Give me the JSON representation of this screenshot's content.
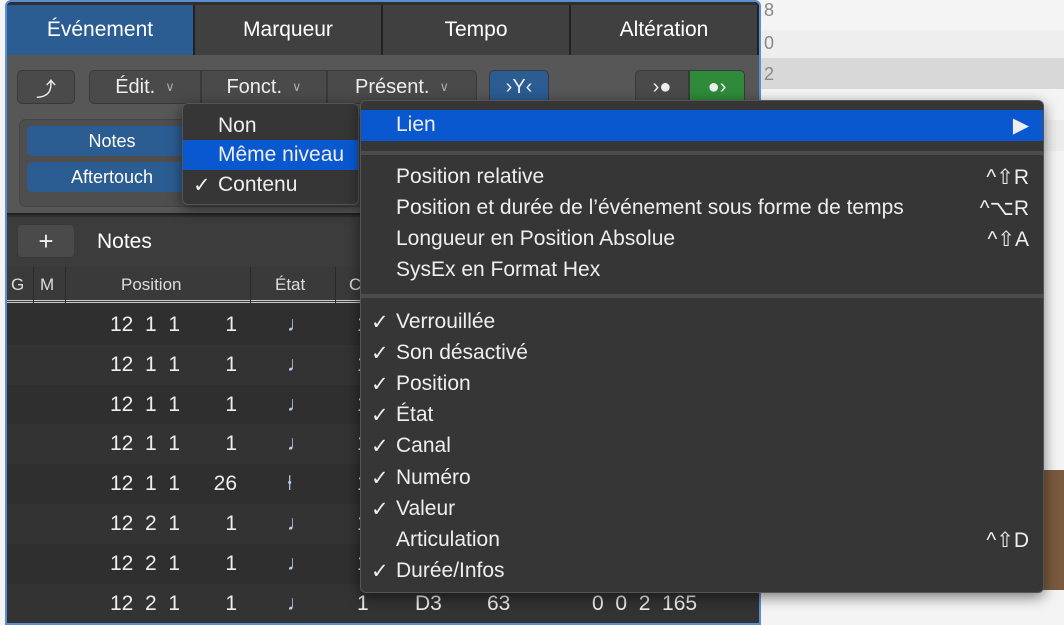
{
  "background": {
    "numbers": [
      "8",
      "0",
      "2"
    ]
  },
  "tabs": [
    {
      "label": "Événement",
      "active": true
    },
    {
      "label": "Marqueur"
    },
    {
      "label": "Tempo"
    },
    {
      "label": "Altération"
    }
  ],
  "toolbar": {
    "back_icon": "curved-arrow-up-icon",
    "edit": "Édit.",
    "functions": "Fonct.",
    "view": "Présent.",
    "filter_icon": "midi-filter-icon",
    "midi_in_icon": "midi-in-icon",
    "midi_out_icon": "midi-out-icon"
  },
  "filters": {
    "notes": "Notes",
    "aftertouch": "Aftertouch"
  },
  "list": {
    "add": "+",
    "title": "Notes",
    "columns": {
      "g": "G",
      "m": "M",
      "position": "Position",
      "state": "État",
      "channel": "C"
    }
  },
  "rows": [
    {
      "pos": "12  1  1",
      "tick": "1",
      "state": "♩",
      "ch": "1"
    },
    {
      "pos": "12  1  1",
      "tick": "1",
      "state": "♩",
      "ch": "1"
    },
    {
      "pos": "12  1  1",
      "tick": "1",
      "state": "♩",
      "ch": "1"
    },
    {
      "pos": "12  1  1",
      "tick": "1",
      "state": "♩",
      "ch": "1"
    },
    {
      "pos": "12  1  1",
      "tick": "26",
      "state": "⍿",
      "ch": "1"
    },
    {
      "pos": "12  2  1",
      "tick": "1",
      "state": "♩",
      "ch": "1"
    },
    {
      "pos": "12  2  1",
      "tick": "1",
      "state": "♩",
      "ch": "1"
    },
    {
      "pos": "12  2  1",
      "tick": "1",
      "state": "♩",
      "ch": "1",
      "num": "D3",
      "val": "63",
      "len": "0  0  2  165"
    }
  ],
  "link_submenu": {
    "items": [
      {
        "label": "Non",
        "checked": false
      },
      {
        "label": "Même niveau",
        "highlighted": true
      },
      {
        "label": "Contenu",
        "checked": true
      }
    ]
  },
  "view_menu": {
    "link": {
      "label": "Lien",
      "arrow": "▶"
    },
    "group1": [
      {
        "label": "Position relative",
        "shortcut": "^⇧R"
      },
      {
        "label": "Position et durée de l’événement sous forme de temps",
        "shortcut": "^⌥R"
      },
      {
        "label": "Longueur en Position Absolue",
        "shortcut": "^⇧A"
      },
      {
        "label": "SysEx en Format Hex",
        "shortcut": ""
      }
    ],
    "group2": [
      {
        "label": "Verrouillée",
        "checked": true,
        "shortcut": ""
      },
      {
        "label": "Son désactivé",
        "checked": true,
        "shortcut": ""
      },
      {
        "label": "Position",
        "checked": true,
        "shortcut": ""
      },
      {
        "label": "État",
        "checked": true,
        "shortcut": ""
      },
      {
        "label": "Canal",
        "checked": true,
        "shortcut": ""
      },
      {
        "label": "Numéro",
        "checked": true,
        "shortcut": ""
      },
      {
        "label": "Valeur",
        "checked": true,
        "shortcut": ""
      },
      {
        "label": "Articulation",
        "checked": false,
        "shortcut": "^⇧D"
      },
      {
        "label": "Durée/Infos",
        "checked": true,
        "shortcut": ""
      }
    ]
  },
  "checkmark": "✓"
}
